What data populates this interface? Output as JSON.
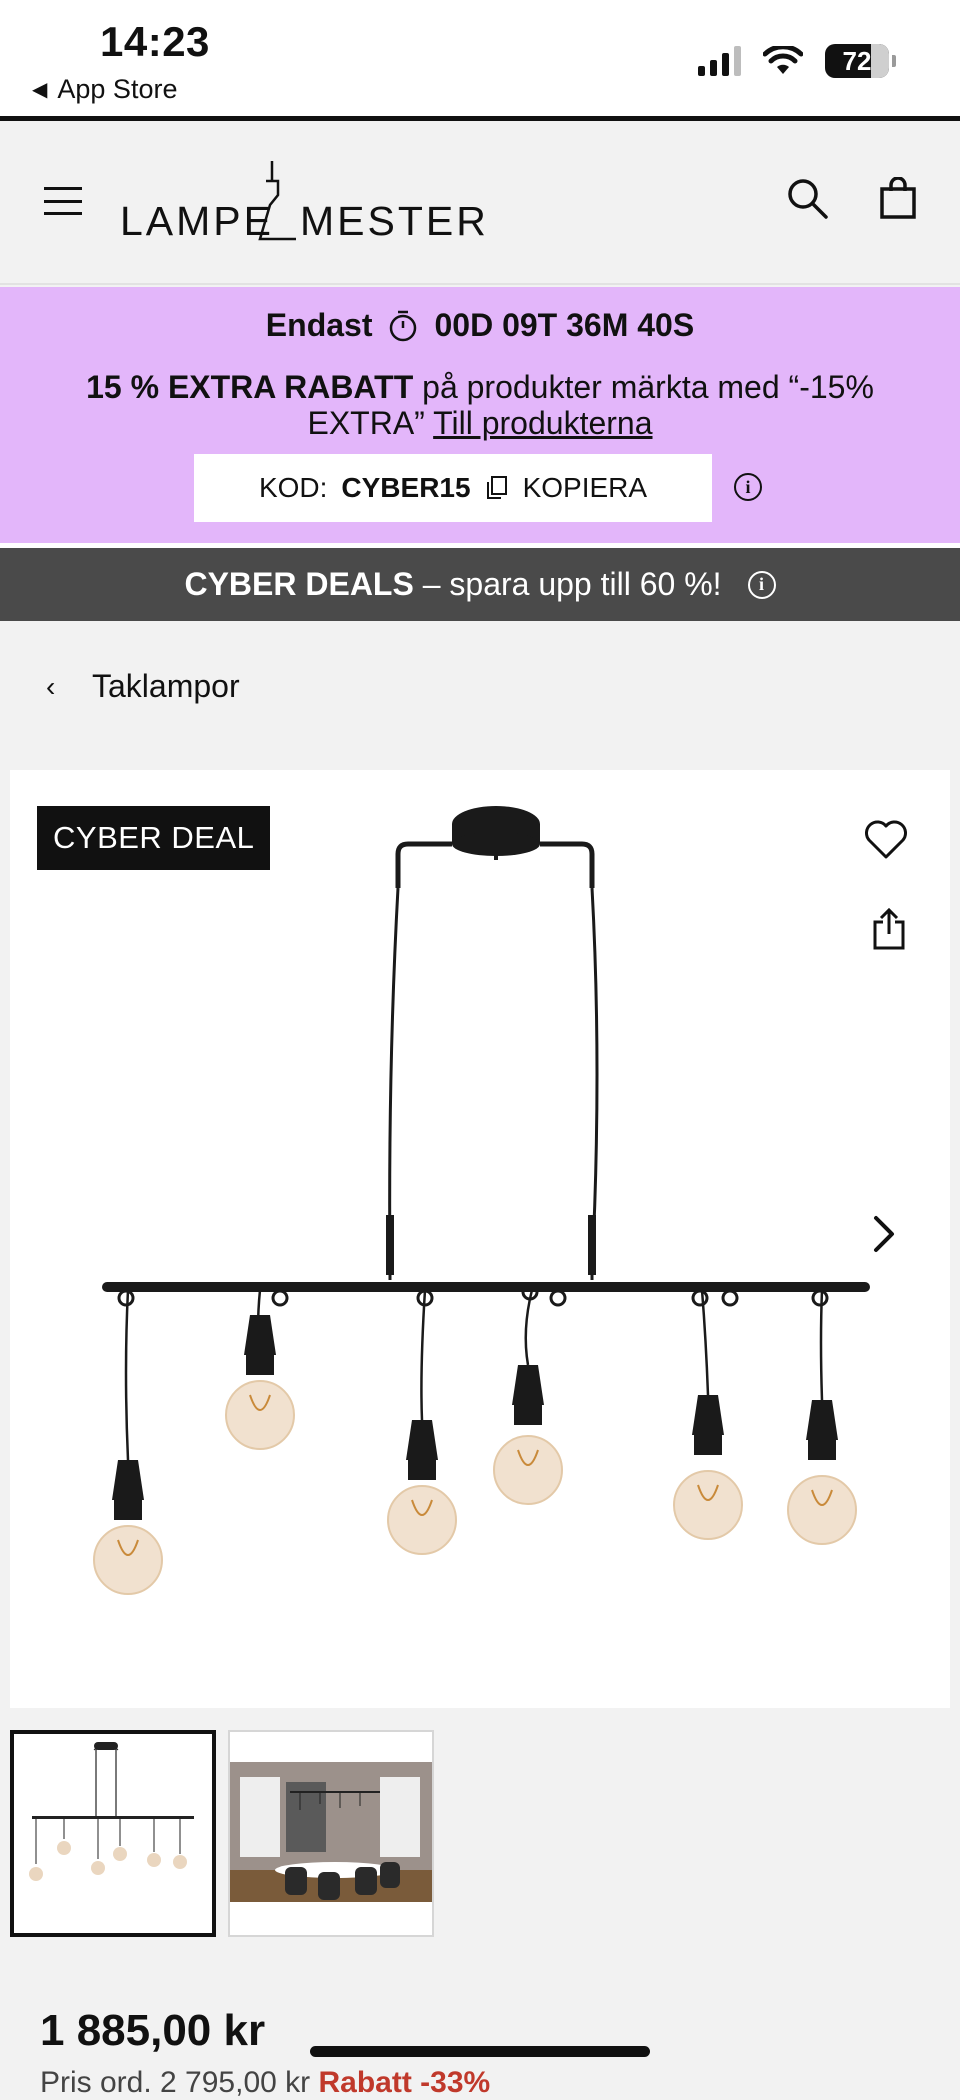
{
  "status_bar": {
    "time": "14:23",
    "back_label": "App Store",
    "battery": "72",
    "icons": [
      "signal-icon",
      "wifi-icon",
      "battery-icon"
    ]
  },
  "header": {
    "logo": "LAMPEMESTEREN",
    "icons": [
      "menu-icon",
      "search-icon",
      "shopping-bag-icon"
    ]
  },
  "promo": {
    "timer_label": "Endast",
    "timer_value": "00D 09T 36M 40S",
    "offer_bold": "15 % EXTRA RABATT",
    "offer_text": " på produkter märkta med “-15% EXTRA” ",
    "offer_link": "Till produkterna",
    "code_label": "KOD:",
    "code_value": "CYBER15",
    "copy_label": "KOPIERA",
    "background_color": "#e3b6fa"
  },
  "deals_bar": {
    "bold": "CYBER DEALS",
    "text": " – spara upp till 60 %!"
  },
  "breadcrumb": {
    "label": "Taklampor"
  },
  "product": {
    "badge": "CYBER DEAL",
    "price": "1 885,00 kr",
    "price_sub_prefix": "Pris ord. 2 795,00 kr",
    "price_sub_discount": "Rabatt -33%"
  },
  "thumbnails": [
    "product-photo",
    "room-photo"
  ]
}
